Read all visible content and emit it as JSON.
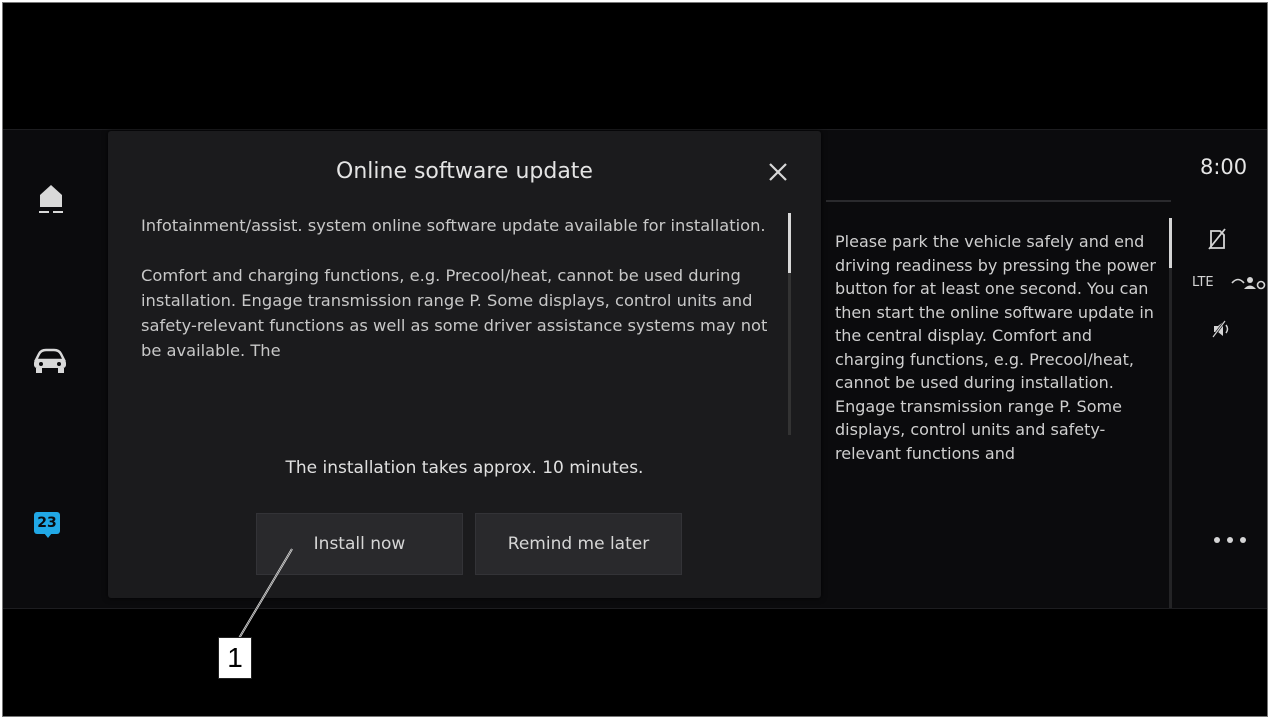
{
  "dialog": {
    "title": "Online software update",
    "body_paragraph_1": "Infotainment/assist. system online software update available for installation.",
    "body_paragraph_2": "Comfort and charging functions, e.g. Precool/heat, cannot be used during installation. Engage transmission range P. Some displays, control units and safety-relevant functions as well as some driver assistance systems may not be available. The",
    "install_time": "The installation takes approx. 10 minutes.",
    "install_button": "Install now",
    "remind_button": "Remind me later"
  },
  "right_panel": {
    "text": "Please park the vehicle safely and end driving readiness by pressing the power button for at least one second. You can then start the online software update in the central display. Comfort and charging functions, e.g. Precool/heat, cannot be used during installation. Engage transmission range P. Some displays, control units and safety-relevant functions and"
  },
  "status_bar": {
    "time": "8:00",
    "network": "LTE"
  },
  "sidebar": {
    "calendar_day": "23"
  },
  "callout": {
    "label": "1"
  },
  "colors": {
    "accent": "#21a8e6",
    "dialog_bg": "#1b1b1d",
    "screen_bg": "#000000"
  },
  "icons": [
    "home-icon",
    "car-icon",
    "calendar-icon",
    "close-icon",
    "no-sim-icon",
    "share-icon",
    "mute-icon",
    "more-icon"
  ]
}
